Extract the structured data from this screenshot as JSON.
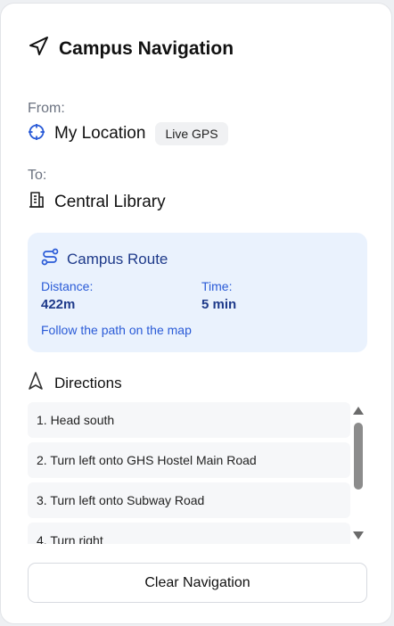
{
  "panel": {
    "title": "Campus Navigation",
    "icon": "navigation-arrow-icon"
  },
  "from": {
    "label": "From:",
    "value": "My Location",
    "badge": "Live GPS",
    "icon": "crosshair-icon"
  },
  "to": {
    "label": "To:",
    "value": "Central Library",
    "icon": "building-icon"
  },
  "route": {
    "title": "Campus Route",
    "icon": "route-icon",
    "distance_label": "Distance:",
    "distance_value": "422m",
    "time_label": "Time:",
    "time_value": "5 min",
    "hint": "Follow the path on the map"
  },
  "directions": {
    "title": "Directions",
    "icon": "direction-arrow-icon",
    "steps": [
      "1. Head south",
      "2. Turn left onto GHS Hostel Main Road",
      "3. Turn left onto Subway Road",
      "4. Turn right"
    ]
  },
  "actions": {
    "clear_label": "Clear Navigation"
  },
  "colors": {
    "accent_blue": "#2a5bd7",
    "route_bg": "#eaf2fd",
    "route_text": "#1e3a8a"
  }
}
